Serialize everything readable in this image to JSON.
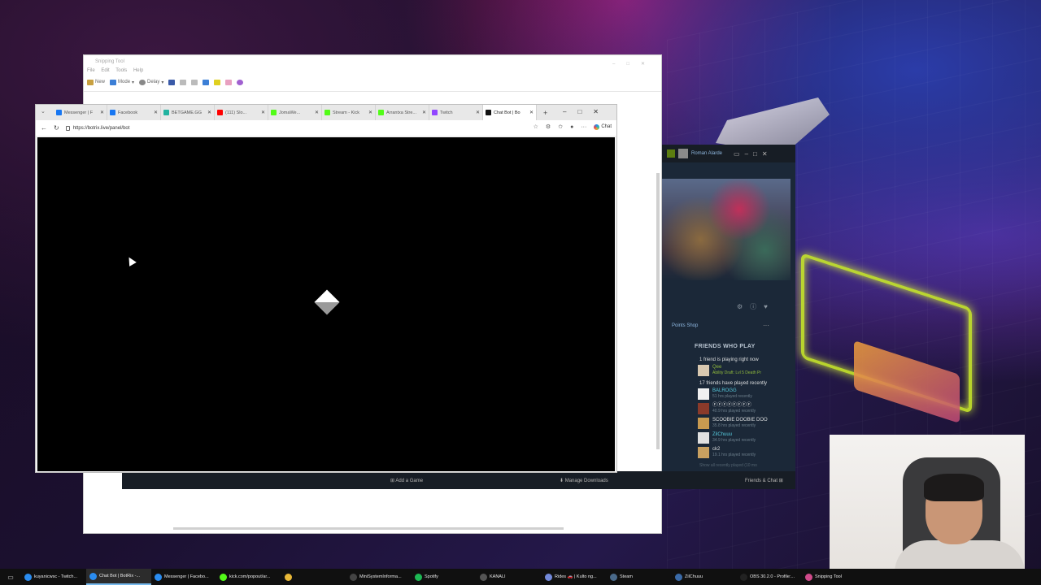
{
  "snipping_tool": {
    "title": "Snipping Tool",
    "menu": [
      "File",
      "Edit",
      "Tools",
      "Help"
    ],
    "toolbar": {
      "new": "New",
      "mode": "Mode",
      "delay": "Delay"
    }
  },
  "browser": {
    "tabs": [
      {
        "label": "Messenger | F",
        "color": "#1877f2"
      },
      {
        "label": "Facebook",
        "color": "#1877f2"
      },
      {
        "label": "BETGAME.GG",
        "color": "#22b3a0"
      },
      {
        "label": "(111) Slo...",
        "color": "#ff0000"
      },
      {
        "label": "JomaWe...",
        "color": "#53fc18"
      },
      {
        "label": "Stream - Kick",
        "color": "#53fc18"
      },
      {
        "label": "Arrantxa Stre...",
        "color": "#53fc18"
      },
      {
        "label": "Twitch",
        "color": "#9146ff"
      },
      {
        "label": "Chat Bot | Bo",
        "color": "#111111",
        "active": true
      }
    ],
    "url": "https://botrix.live/panel/bot",
    "chat_label": "Chat"
  },
  "steam": {
    "username": "Roman Alarde",
    "points_shop": "Points Shop",
    "friends_who_play": "FRIENDS WHO PLAY",
    "playing_now_header": "1 friend is playing right now",
    "playing_now": [
      {
        "name": "Qee",
        "status": "Ability Draft: Lvl 5 Death Pr"
      }
    ],
    "recent_header": "17 friends have played recently",
    "recent": [
      {
        "name": "BALROGG",
        "hours": "51 hrs played recently"
      },
      {
        "name": "ⒻⒻⒻⒻⒻⒻⒻⒻ",
        "hours": "40.9 hrs played recently"
      },
      {
        "name": "SCOOBIE DOOBIE DOO",
        "hours": "35.8 hrs played recently"
      },
      {
        "name": "ZilChuuu",
        "hours": "34.9 hrs played recently"
      },
      {
        "name": "ck2",
        "hours": "19.1 hrs played recently"
      }
    ],
    "show_all": "Show all recently played (10 mo",
    "footer": {
      "add_game": "Add a Game",
      "manage_downloads": "Manage Downloads",
      "friends_chat": "Friends & Chat"
    }
  },
  "taskbar": {
    "items": [
      {
        "label": "kuyanicwsc - Twitch...",
        "color": "#2a8cf0"
      },
      {
        "label": "Chat Bot | BotRix -...",
        "color": "#2a8cf0",
        "active": true
      },
      {
        "label": "Messenger | Facebo...",
        "color": "#2a8cf0"
      },
      {
        "label": "kick.com/popout/ar...",
        "color": "#53fc18"
      },
      {
        "label": "",
        "color": "#e8b838"
      },
      {
        "label": "MiniSystemInforma...",
        "color": "#444444"
      },
      {
        "label": "Spotify",
        "color": "#1db954"
      },
      {
        "label": "KANALI",
        "color": "#555555"
      },
      {
        "label": "Rides 🚗 | Kulto ng...",
        "color": "#7289da"
      },
      {
        "label": "Steam",
        "color": "#4a6a8a"
      },
      {
        "label": "ZilChuuu",
        "color": "#3a6aa8"
      },
      {
        "label": "OBS 30.2.0 - Profile:...",
        "color": "#222222"
      },
      {
        "label": "Snipping Tool",
        "color": "#d04a8a"
      }
    ]
  }
}
